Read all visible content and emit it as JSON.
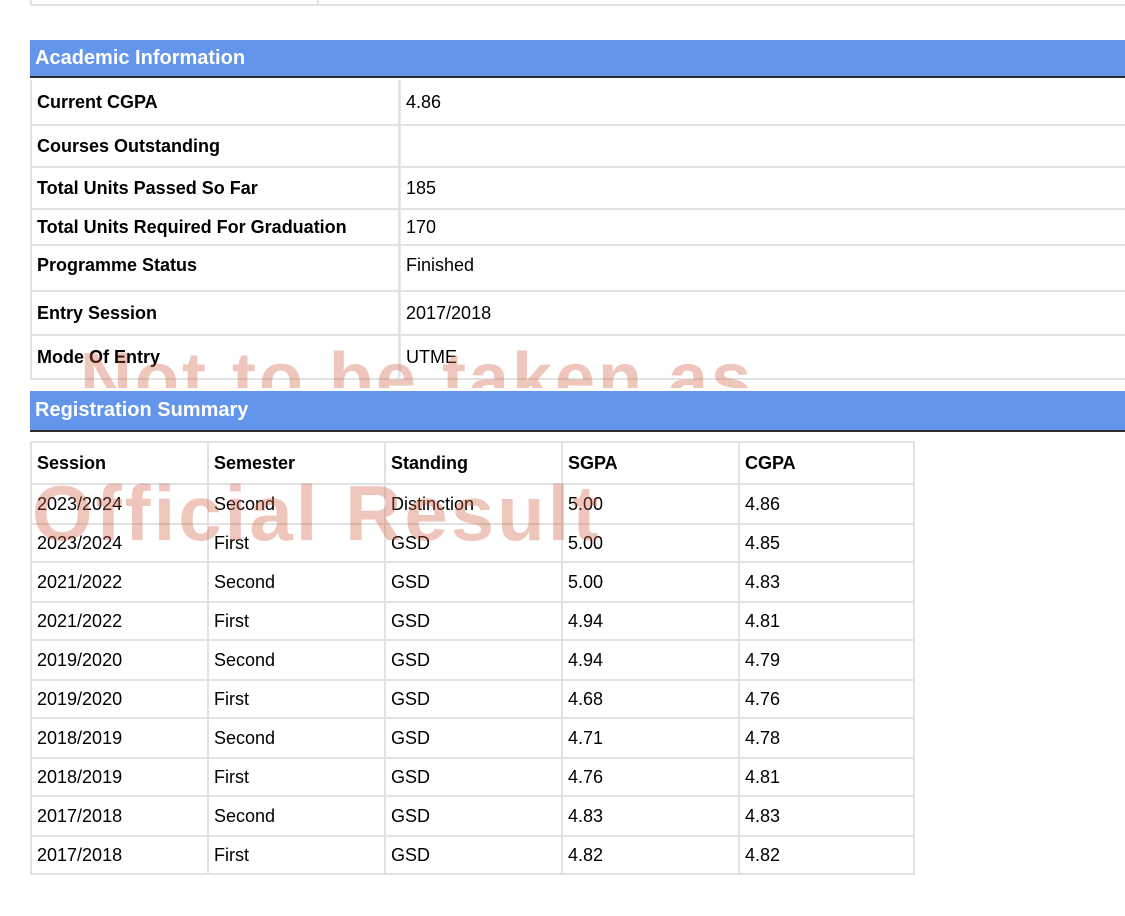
{
  "academic": {
    "header": "Academic Information",
    "rows": [
      {
        "label": "Current CGPA",
        "value": "4.86"
      },
      {
        "label": "Courses Outstanding",
        "value": ""
      },
      {
        "label": "Total Units Passed So Far",
        "value": "185"
      },
      {
        "label": "Total Units Required For Graduation",
        "value": "170"
      },
      {
        "label": "Programme Status",
        "value": "Finished"
      },
      {
        "label": "Entry Session",
        "value": "2017/2018"
      },
      {
        "label": "Mode Of Entry",
        "value": "UTME"
      }
    ]
  },
  "registration": {
    "header": "Registration Summary",
    "columns": [
      "Session",
      "Semester",
      "Standing",
      "SGPA",
      "CGPA"
    ],
    "rows": [
      [
        "2023/2024",
        "Second",
        "Distinction",
        "5.00",
        "4.86"
      ],
      [
        "2023/2024",
        "First",
        "GSD",
        "5.00",
        "4.85"
      ],
      [
        "2021/2022",
        "Second",
        "GSD",
        "5.00",
        "4.83"
      ],
      [
        "2021/2022",
        "First",
        "GSD",
        "4.94",
        "4.81"
      ],
      [
        "2019/2020",
        "Second",
        "GSD",
        "4.94",
        "4.79"
      ],
      [
        "2019/2020",
        "First",
        "GSD",
        "4.68",
        "4.76"
      ],
      [
        "2018/2019",
        "Second",
        "GSD",
        "4.71",
        "4.78"
      ],
      [
        "2018/2019",
        "First",
        "GSD",
        "4.76",
        "4.81"
      ],
      [
        "2017/2018",
        "Second",
        "GSD",
        "4.83",
        "4.83"
      ],
      [
        "2017/2018",
        "First",
        "GSD",
        "4.82",
        "4.82"
      ]
    ]
  },
  "watermark": {
    "line1": "Not to be taken as",
    "line2": "Official Result"
  }
}
